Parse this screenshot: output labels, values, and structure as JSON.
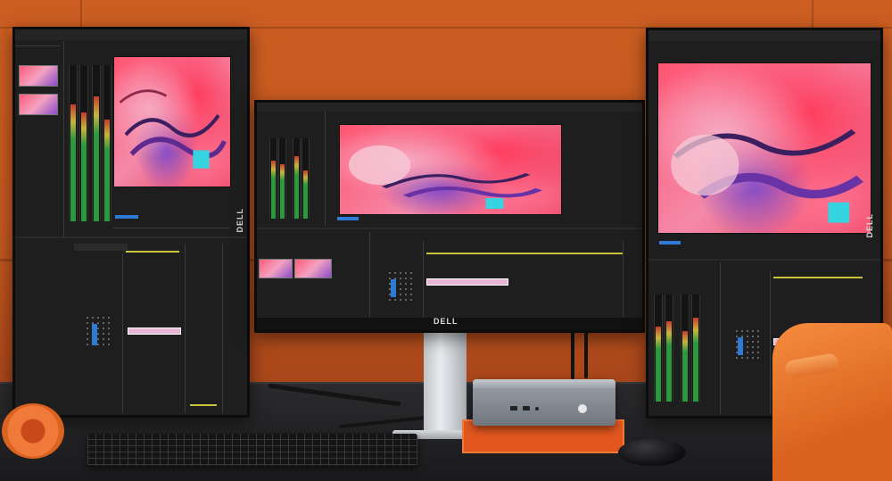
{
  "monitors": {
    "left": {
      "brand": "DELL"
    },
    "center": {
      "brand": "DELL"
    },
    "right": {
      "brand": "DELL"
    }
  },
  "palette": {
    "wall": "#c45820",
    "desk": "#1a1a1c",
    "accent_pink": "#ff5470",
    "accent_purple": "#7b47c9",
    "ui_dark": "#1e1e1e",
    "ui_blue": "#2e7bd6",
    "clip": "#e7b7d8"
  },
  "objects": [
    "monitor-left-portrait",
    "monitor-center",
    "monitor-right-portrait",
    "mini-pc",
    "keyboard",
    "mouse",
    "headphones",
    "chair"
  ]
}
